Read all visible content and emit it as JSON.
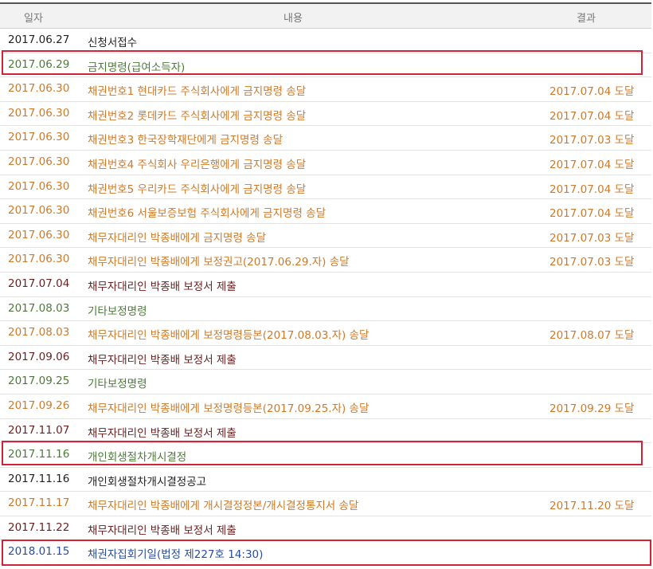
{
  "headers": {
    "date": "일자",
    "content": "내용",
    "result": "결과"
  },
  "rows": [
    {
      "date": "2017.06.27",
      "content": "신청서접수",
      "result": "",
      "color": "black"
    },
    {
      "date": "2017.06.29",
      "content": "금지명령(급여소득자)",
      "result": "",
      "color": "green"
    },
    {
      "date": "2017.06.30",
      "content": "채권번호1 현대카드 주식회사에게 금지명령 송달",
      "result": "2017.07.04 도달",
      "color": "orange"
    },
    {
      "date": "2017.06.30",
      "content": "채권번호2 롯데카드 주식회사에게 금지명령 송달",
      "result": "2017.07.04 도달",
      "color": "orange"
    },
    {
      "date": "2017.06.30",
      "content": "채권번호3 한국장학재단에게 금지명령 송달",
      "result": "2017.07.03 도달",
      "color": "orange"
    },
    {
      "date": "2017.06.30",
      "content": "채권번호4 주식회사 우리은행에게 금지명령 송달",
      "result": "2017.07.04 도달",
      "color": "orange"
    },
    {
      "date": "2017.06.30",
      "content": "채권번호5 우리카드 주식회사에게 금지명령 송달",
      "result": "2017.07.04 도달",
      "color": "orange"
    },
    {
      "date": "2017.06.30",
      "content": "채권번호6 서울보증보험 주식회사에게 금지명령 송달",
      "result": "2017.07.04 도달",
      "color": "orange"
    },
    {
      "date": "2017.06.30",
      "content": "채무자대리인 박종배에게 금지명령 송달",
      "result": "2017.07.03 도달",
      "color": "orange"
    },
    {
      "date": "2017.06.30",
      "content": "채무자대리인 박종배에게 보정권고(2017.06.29.자) 송달",
      "result": "2017.07.03 도달",
      "color": "orange"
    },
    {
      "date": "2017.07.04",
      "content": "채무자대리인 박종배 보정서 제출",
      "result": "",
      "color": "maroon"
    },
    {
      "date": "2017.08.03",
      "content": "기타보정명령",
      "result": "",
      "color": "green"
    },
    {
      "date": "2017.08.03",
      "content": "채무자대리인 박종배에게 보정명령등본(2017.08.03.자) 송달",
      "result": "2017.08.07 도달",
      "color": "orange"
    },
    {
      "date": "2017.09.06",
      "content": "채무자대리인 박종배 보정서 제출",
      "result": "",
      "color": "maroon"
    },
    {
      "date": "2017.09.25",
      "content": "기타보정명령",
      "result": "",
      "color": "green"
    },
    {
      "date": "2017.09.26",
      "content": "채무자대리인 박종배에게 보정명령등본(2017.09.25.자) 송달",
      "result": "2017.09.29 도달",
      "color": "orange"
    },
    {
      "date": "2017.11.07",
      "content": "채무자대리인 박종배 보정서 제출",
      "result": "",
      "color": "maroon"
    },
    {
      "date": "2017.11.16",
      "content": "개인회생절차개시결정",
      "result": "",
      "color": "green"
    },
    {
      "date": "2017.11.16",
      "content": "개인회생절차개시결정공고",
      "result": "",
      "color": "black"
    },
    {
      "date": "2017.11.17",
      "content": "채무자대리인 박종배에게 개시결정정본/개시결정통지서 송달",
      "result": "2017.11.20 도달",
      "color": "orange"
    },
    {
      "date": "2017.11.22",
      "content": "채무자대리인 박종배 보정서 제출",
      "result": "",
      "color": "maroon"
    },
    {
      "date": "2018.01.15",
      "content": "채권자집회기일(법정 제227호 14:30)",
      "result": "",
      "color": "blue"
    }
  ],
  "highlight_color": "#d0243a"
}
